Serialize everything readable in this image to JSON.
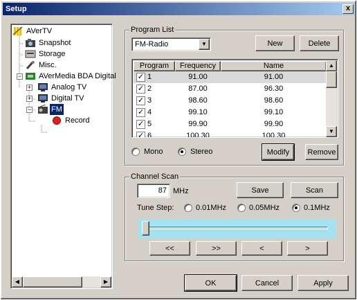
{
  "window": {
    "title": "Setup",
    "close_glyph": "x"
  },
  "tree": {
    "items": [
      {
        "label": "AVerTV",
        "icon": "avertv-icon"
      },
      {
        "label": "Snapshot",
        "icon": "camera-icon"
      },
      {
        "label": "Storage",
        "icon": "storage-icon"
      },
      {
        "label": "Misc.",
        "icon": "misc-icon"
      },
      {
        "label": "AVerMedia BDA Digital",
        "icon": "device-icon",
        "expander": "−"
      },
      {
        "label": "Analog TV",
        "icon": "tv-icon",
        "expander": "+"
      },
      {
        "label": "Digital TV",
        "icon": "tv-icon",
        "expander": "+"
      },
      {
        "label": "FM",
        "icon": "radio-icon",
        "expander": "−",
        "selected": true
      },
      {
        "label": "Record",
        "icon": "record-icon"
      }
    ]
  },
  "program_list": {
    "title": "Program List",
    "source_value": "FM-Radio",
    "new_label": "New",
    "delete_label": "Delete",
    "columns": [
      "Program",
      "Frequency",
      "Name"
    ],
    "rows": [
      {
        "program": "1",
        "frequency": "91.00",
        "name": "91.00",
        "checked": true
      },
      {
        "program": "2",
        "frequency": "87.00",
        "name": "96.30",
        "checked": true
      },
      {
        "program": "3",
        "frequency": "98.60",
        "name": "98.60",
        "checked": true
      },
      {
        "program": "4",
        "frequency": "99.10",
        "name": "99.10",
        "checked": true
      },
      {
        "program": "5",
        "frequency": "99.90",
        "name": "99.90",
        "checked": true
      },
      {
        "program": "6",
        "frequency": "100.30",
        "name": "100.30",
        "checked": true
      }
    ],
    "mono_label": "Mono",
    "stereo_label": "Stereo",
    "audio_mode": "stereo",
    "modify_label": "Modify",
    "remove_label": "Remove"
  },
  "channel_scan": {
    "title": "Channel Scan",
    "frequency_value": "87",
    "unit": "MHz",
    "save_label": "Save",
    "scan_label": "Scan",
    "tune_step_label": "Tune Step:",
    "steps": [
      "0.01MHz",
      "0.05MHz",
      "0.1MHz"
    ],
    "selected_step": "0.1MHz",
    "slider_level": 0.0,
    "nav": [
      "<<",
      ">>",
      "<",
      ">"
    ]
  },
  "footer": {
    "ok_label": "OK",
    "cancel_label": "Cancel",
    "apply_label": "Apply"
  }
}
